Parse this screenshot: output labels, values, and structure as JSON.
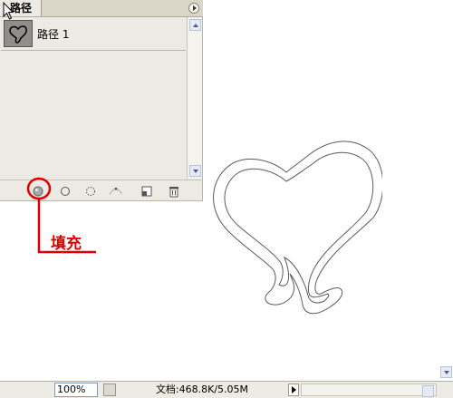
{
  "panel": {
    "tab_label": "路径",
    "paths": [
      {
        "label": "路径 1"
      }
    ],
    "footer_buttons": [
      {
        "name": "fill-path-icon",
        "tooltip": ""
      },
      {
        "name": "stroke-path-icon",
        "tooltip": ""
      },
      {
        "name": "load-as-selection-icon",
        "tooltip": ""
      },
      {
        "name": "make-work-path-icon",
        "tooltip": ""
      },
      {
        "name": "new-path-icon",
        "tooltip": ""
      },
      {
        "name": "delete-path-icon",
        "tooltip": ""
      }
    ]
  },
  "annotation": {
    "label": "填充",
    "color": "#dd0000"
  },
  "status_bar": {
    "zoom": "100%",
    "doc_info": "文档:468.8K/5.05M"
  }
}
